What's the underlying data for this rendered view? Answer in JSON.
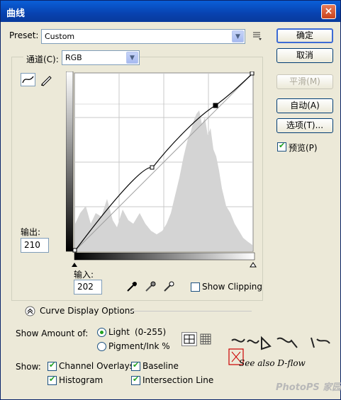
{
  "window": {
    "title": "曲线",
    "close": "×"
  },
  "preset": {
    "label": "Preset:",
    "value": "Custom"
  },
  "channel": {
    "label": "通道(C):",
    "value": "RGB"
  },
  "buttons": {
    "ok": "确定",
    "cancel": "取消",
    "smooth": "平滑(M)",
    "auto": "自动(A)",
    "options": "选项(T)...",
    "preview": "预览(P)"
  },
  "output": {
    "label": "输出:",
    "value": "210"
  },
  "input": {
    "label": "输入:",
    "value": "202"
  },
  "show_clipping": "Show Clipping",
  "display_options": "Curve Display Options",
  "show_amount": {
    "label": "Show Amount of:",
    "light": "Light",
    "light_range": "(0-255)",
    "pigment": "Pigment/Ink %"
  },
  "show": {
    "label": "Show:",
    "channel_overlays": "Channel Overlays",
    "baseline": "Baseline",
    "histogram": "Histogram",
    "intersection": "Intersection Line"
  },
  "watermark": {
    "see_also": "See also D-flow",
    "site": "PhotoPS 家园"
  },
  "curve_points": [
    [
      0,
      0
    ],
    [
      101,
      113
    ],
    [
      181,
      210
    ],
    [
      255,
      255
    ]
  ],
  "colors": {
    "titlebar": "#0842b0",
    "accent_green": "#21a121"
  }
}
